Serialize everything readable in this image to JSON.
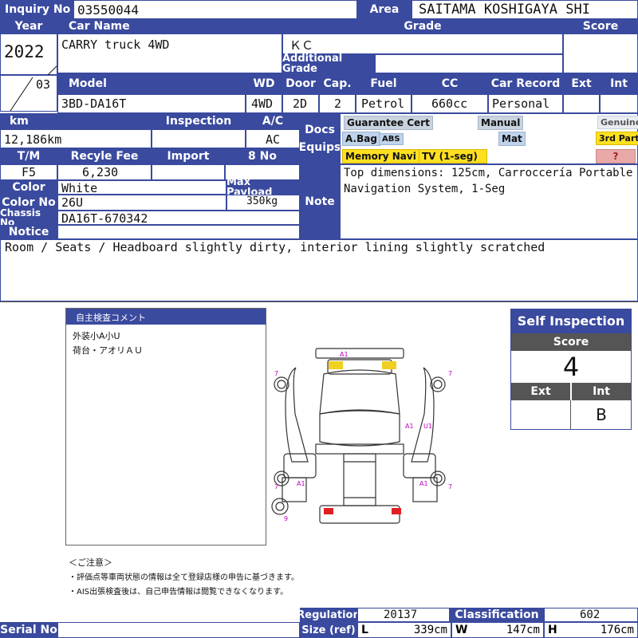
{
  "labels": {
    "inquiry_no": "Inquiry No",
    "area": "Area",
    "year": "Year",
    "car_name": "Car Name",
    "grade": "Grade",
    "score": "Score",
    "additional_grade": "Additional Grade",
    "model": "Model",
    "wd": "WD",
    "door": "Door",
    "cap": "Cap.",
    "fuel": "Fuel",
    "cc": "CC",
    "car_record": "Car Record",
    "ext": "Ext",
    "int": "Int",
    "km": "km",
    "inspection": "Inspection",
    "ac": "A/C",
    "docs_equips": "Docs Equips",
    "tm": "T/M",
    "recycle_fee": "Recyle Fee",
    "import": "Import",
    "no8": "8 No",
    "color": "Color",
    "max_payload": "Max Payload",
    "color_no": "Color No",
    "note": "Note",
    "chassis_no": "Chassis No",
    "notice": "Notice",
    "serial_no": "Serial No",
    "regulation": "Regulation",
    "classification": "Classification",
    "size_ref": "Size (ref)",
    "l": "L",
    "w": "W",
    "h": "H"
  },
  "vehicle": {
    "inquiry_no": "03550044",
    "area": "SAITAMA KOSHIGAYA SHI",
    "year": "2022",
    "month": "03",
    "car_name": "CARRY truck 4WD",
    "grade": "ＫＣ",
    "additional_grade": "",
    "score": "",
    "model": "3BD-DA16T",
    "wd": "4WD",
    "door": "2D",
    "cap": "2",
    "fuel": "Petrol",
    "cc": "660cc",
    "car_record": "Personal",
    "ext": "",
    "int": "",
    "km": "12,186km",
    "inspection": "",
    "ac": "AC",
    "tm": "F5",
    "recycle_fee": "6,230",
    "import": "",
    "no8": "",
    "color": "White",
    "max_payload": "350kg",
    "color_no": "26U",
    "chassis_no": "DA16T-670342",
    "serial_no": "",
    "regulation": "20137",
    "classification": "602",
    "size_l": "339cm",
    "size_w": "147cm",
    "size_h": "176cm"
  },
  "equipment": {
    "guarantee_cert": "Guarantee Cert",
    "manual": "Manual",
    "genuine": "Genuine",
    "abag": "A.Bag",
    "abs": "ABS",
    "mat": "Mat",
    "third_party": "3rd Party",
    "memory_navi": "Memory Navi",
    "tv": "TV (1-seg)",
    "question": "?"
  },
  "note_text": "Top dimensions: 125cm, Carroccería Portable Navigation System, 1-Seg",
  "notice_text": "Room / Seats / Headboard slightly dirty, interior lining slightly scratched",
  "inspection_sheet": {
    "title": "自主検査コメント",
    "lines": [
      "外装小A小U",
      "荷台・アオリＡＵ"
    ],
    "diagram_marks": [
      "A1",
      "7",
      "7",
      "A1",
      "U1",
      "7",
      "A1",
      "7",
      "A1",
      "9"
    ],
    "caution_title": "＜ご注意＞",
    "caution_lines": [
      "・評価点等車両状態の情報は全て登録店様の申告に基づきます。",
      "・AIS出張検査後は、自己申告情報は閲覧できなくなります。"
    ]
  },
  "self_inspection": {
    "title": "Self Inspection",
    "score_label": "Score",
    "score": "4",
    "ext_label": "Ext",
    "int_label": "Int",
    "ext": "",
    "int": "B"
  },
  "colors": {
    "header": "#3a4a9e",
    "highlight_yellow": "#ffe020",
    "highlight_blue": "#bfd3ea",
    "damage_red": "#e02020",
    "mark_magenta": "#c000c0"
  }
}
